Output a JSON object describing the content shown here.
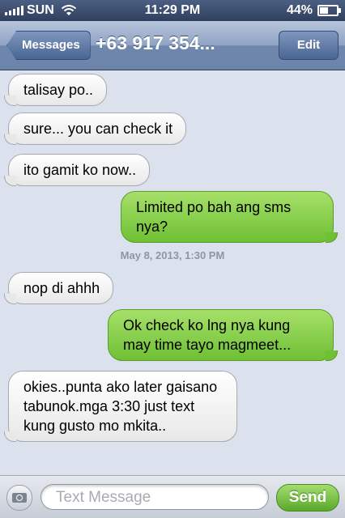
{
  "status_bar": {
    "carrier": "SUN",
    "time": "11:29 PM",
    "battery": "44%",
    "battery_level": 0.44,
    "icons": [
      "signal-bars-icon",
      "wifi-icon",
      "battery-icon"
    ]
  },
  "nav": {
    "back_label": "Messages",
    "title": "+63 917 354...",
    "edit_label": "Edit"
  },
  "messages": [
    {
      "from": "them",
      "text": "talisay po.."
    },
    {
      "from": "them",
      "text": "sure... you can check it"
    },
    {
      "from": "them",
      "text": "ito gamit ko now.."
    },
    {
      "from": "me",
      "text": "Limited po bah ang sms nya?"
    },
    {
      "from": "them",
      "text": "nop di ahhh"
    },
    {
      "from": "me",
      "text": "Ok check ko lng nya kung may time tayo magmeet..."
    },
    {
      "from": "them",
      "text": "okies..punta ako later gaisano tabunok.mga 3:30 just text kung gusto mo mkita.."
    }
  ],
  "timestamp": "May 8, 2013, 1:30 PM",
  "input": {
    "placeholder": "Text Message",
    "send_label": "Send",
    "camera_icon": "camera-icon"
  },
  "colors": {
    "outgoing_bubble": "#7ec843",
    "incoming_bubble": "#f2f2f2",
    "nav_bar": "#8fa3c4"
  }
}
